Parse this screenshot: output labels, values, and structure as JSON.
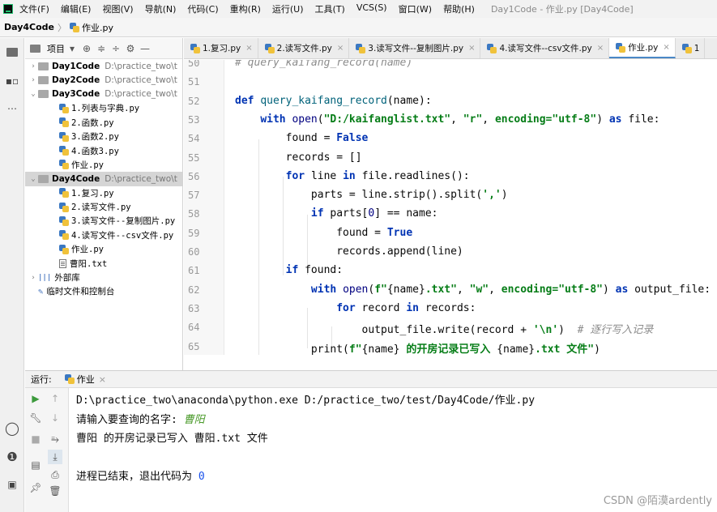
{
  "menubar": {
    "items": [
      "文件(F)",
      "编辑(E)",
      "视图(V)",
      "导航(N)",
      "代码(C)",
      "重构(R)",
      "运行(U)",
      "工具(T)",
      "VCS(S)",
      "窗口(W)",
      "帮助(H)"
    ],
    "title": "Day1Code - 作业.py [Day4Code]"
  },
  "breadcrumb": {
    "project": "Day4Code",
    "file": "作业.py"
  },
  "project_panel": {
    "label": "项目"
  },
  "tree": [
    {
      "indent": 0,
      "arrow": "›",
      "kind": "folder",
      "name": "Day1Code",
      "path": "D:\\practice_two\\t",
      "bold": true,
      "sel": false
    },
    {
      "indent": 0,
      "arrow": "›",
      "kind": "folder",
      "name": "Day2Code",
      "path": "D:\\practice_two\\t",
      "bold": true,
      "sel": false
    },
    {
      "indent": 0,
      "arrow": "⌄",
      "kind": "folder",
      "name": "Day3Code",
      "path": "D:\\practice_two\\t",
      "bold": true,
      "sel": false
    },
    {
      "indent": 1,
      "arrow": "",
      "kind": "py",
      "name": "1.列表与字典.py",
      "path": "",
      "bold": false,
      "sel": false
    },
    {
      "indent": 1,
      "arrow": "",
      "kind": "py",
      "name": "2.函数.py",
      "path": "",
      "bold": false,
      "sel": false
    },
    {
      "indent": 1,
      "arrow": "",
      "kind": "py",
      "name": "3.函数2.py",
      "path": "",
      "bold": false,
      "sel": false
    },
    {
      "indent": 1,
      "arrow": "",
      "kind": "py",
      "name": "4.函数3.py",
      "path": "",
      "bold": false,
      "sel": false
    },
    {
      "indent": 1,
      "arrow": "",
      "kind": "py",
      "name": "作业.py",
      "path": "",
      "bold": false,
      "sel": false
    },
    {
      "indent": 0,
      "arrow": "⌄",
      "kind": "folder",
      "name": "Day4Code",
      "path": "D:\\practice_two\\t",
      "bold": true,
      "sel": true
    },
    {
      "indent": 1,
      "arrow": "",
      "kind": "py",
      "name": "1.复习.py",
      "path": "",
      "bold": false,
      "sel": false
    },
    {
      "indent": 1,
      "arrow": "",
      "kind": "py",
      "name": "2.读写文件.py",
      "path": "",
      "bold": false,
      "sel": false
    },
    {
      "indent": 1,
      "arrow": "",
      "kind": "py",
      "name": "3.读写文件--复制图片.py",
      "path": "",
      "bold": false,
      "sel": false
    },
    {
      "indent": 1,
      "arrow": "",
      "kind": "py",
      "name": "4.读写文件--csv文件.py",
      "path": "",
      "bold": false,
      "sel": false
    },
    {
      "indent": 1,
      "arrow": "",
      "kind": "py",
      "name": "作业.py",
      "path": "",
      "bold": false,
      "sel": false
    },
    {
      "indent": 1,
      "arrow": "",
      "kind": "txt",
      "name": "曹阳.txt",
      "path": "",
      "bold": false,
      "sel": false
    },
    {
      "indent": 0,
      "arrow": "›",
      "kind": "lib",
      "name": "外部库",
      "path": "",
      "bold": false,
      "sel": false
    },
    {
      "indent": 0,
      "arrow": "",
      "kind": "scratch",
      "name": "临时文件和控制台",
      "path": "",
      "bold": false,
      "sel": false
    }
  ],
  "tabs": [
    {
      "label": "1.复习.py",
      "active": false
    },
    {
      "label": "2.读写文件.py",
      "active": false
    },
    {
      "label": "3.读写文件--复制图片.py",
      "active": false
    },
    {
      "label": "4.读写文件--csv文件.py",
      "active": false
    },
    {
      "label": "作业.py",
      "active": true
    },
    {
      "label": "1",
      "active": false
    }
  ],
  "editor": {
    "line_numbers": [
      50,
      51,
      52,
      53,
      54,
      55,
      56,
      57,
      58,
      59,
      60,
      61,
      62,
      63,
      64,
      65
    ],
    "lines": [
      [
        [
          "cm",
          "# query_kaifang_record(name)"
        ]
      ],
      [],
      [
        [
          "kw",
          "def "
        ],
        [
          "fn",
          "query_kaifang_record"
        ],
        [
          "",
          "(name):"
        ]
      ],
      [
        [
          "",
          "    "
        ],
        [
          "kw",
          "with "
        ],
        [
          "bi",
          "open"
        ],
        [
          "",
          "("
        ],
        [
          "st",
          "\"D:/kaifanglist.txt\""
        ],
        [
          "",
          ", "
        ],
        [
          "st",
          "\"r\""
        ],
        [
          "",
          ", "
        ],
        [
          "st",
          "encoding="
        ],
        [
          "st",
          "\"utf-8\""
        ],
        [
          "",
          ") "
        ],
        [
          "kw",
          "as "
        ],
        [
          "",
          "file:"
        ]
      ],
      [
        [
          "",
          "        found = "
        ],
        [
          "kw",
          "False"
        ]
      ],
      [
        [
          "",
          "        records = []"
        ]
      ],
      [
        [
          "",
          "        "
        ],
        [
          "kw",
          "for "
        ],
        [
          "",
          "line "
        ],
        [
          "kw",
          "in "
        ],
        [
          "",
          "file.readlines():"
        ]
      ],
      [
        [
          "",
          "            parts = line.strip().split("
        ],
        [
          "st",
          "','"
        ],
        [
          "",
          ")"
        ]
      ],
      [
        [
          "",
          "            "
        ],
        [
          "kw",
          "if "
        ],
        [
          "",
          "parts["
        ],
        [
          "bi",
          "0"
        ],
        [
          "",
          "] == name:"
        ]
      ],
      [
        [
          "",
          "                found = "
        ],
        [
          "kw",
          "True"
        ]
      ],
      [
        [
          "",
          "                records.append(line)"
        ]
      ],
      [
        [
          "",
          "        "
        ],
        [
          "kw",
          "if "
        ],
        [
          "",
          "found:"
        ]
      ],
      [
        [
          "",
          "            "
        ],
        [
          "kw",
          "with "
        ],
        [
          "bi",
          "open"
        ],
        [
          "",
          "("
        ],
        [
          "st",
          "f\""
        ],
        [
          "",
          "{name}"
        ],
        [
          "st",
          ".txt\""
        ],
        [
          "",
          ", "
        ],
        [
          "st",
          "\"w\""
        ],
        [
          "",
          ", "
        ],
        [
          "st",
          "encoding="
        ],
        [
          "st",
          "\"utf-8\""
        ],
        [
          "",
          ") "
        ],
        [
          "kw",
          "as "
        ],
        [
          "",
          "output_file:"
        ]
      ],
      [
        [
          "",
          "                "
        ],
        [
          "kw",
          "for "
        ],
        [
          "",
          "record "
        ],
        [
          "kw",
          "in "
        ],
        [
          "",
          "records:"
        ]
      ],
      [
        [
          "",
          "                    output_file.write(record + "
        ],
        [
          "st",
          "'\\n'"
        ],
        [
          "",
          ")  "
        ],
        [
          "cm",
          "# 逐行写入记录"
        ]
      ],
      [
        [
          "",
          "            print("
        ],
        [
          "st",
          "f\""
        ],
        [
          "",
          "{name}"
        ],
        [
          "st",
          " 的开房记录已写入 "
        ],
        [
          "",
          "{name}"
        ],
        [
          "st",
          ".txt 文件\""
        ],
        [
          "",
          ")"
        ]
      ]
    ]
  },
  "run": {
    "label": "运行:",
    "tab": "作业",
    "console": [
      {
        "parts": [
          [
            "",
            "D:\\practice_two\\anaconda\\python.exe D:/practice_two/test/Day4Code/作业.py"
          ]
        ]
      },
      {
        "parts": [
          [
            "",
            "请输入要查询的名字: "
          ],
          [
            "green",
            "曹阳"
          ]
        ]
      },
      {
        "parts": [
          [
            "",
            "曹阳 的开房记录已写入 曹阳.txt 文件"
          ]
        ]
      },
      {
        "parts": []
      },
      {
        "parts": [
          [
            "",
            "进程已结束，退出代码为 "
          ],
          [
            "blue",
            "0"
          ]
        ]
      }
    ]
  },
  "watermark": "CSDN @陌漠ardently"
}
